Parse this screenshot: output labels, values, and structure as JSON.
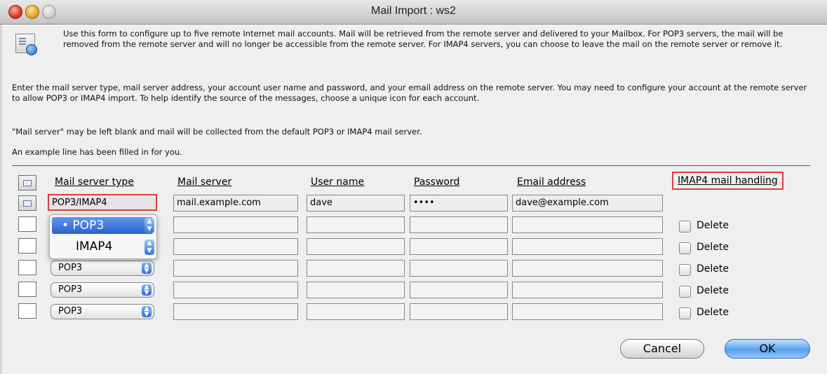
{
  "window": {
    "title": "Mail Import : ws2"
  },
  "intro": {
    "p1": "Use this form to configure up to five remote Internet mail accounts. Mail will be retrieved from the remote server and delivered to your Mailbox.  For POP3 servers, the mail will be removed from the remote server and will no longer be accessible from the remote server. For IMAP4 servers, you can choose to leave the mail on the remote server or remove it.",
    "p2": "Enter the mail server type, mail server address, your account user name and password, and your email address on the remote server. You may need to configure your account at the remote server to allow POP3 or IMAP4 import.  To help identify the source of the messages, choose a unique icon for each account.",
    "p3": "\"Mail server\" may be left blank and mail will be collected from the default POP3 or IMAP4 mail server.",
    "p4": "An example line has been filled in for you."
  },
  "columns": {
    "type": "Mail server type",
    "server": "Mail server",
    "user": "User name",
    "password": "Password",
    "email": "Email address",
    "imap": "IMAP4 mail handling"
  },
  "example": {
    "type": "POP3/IMAP4",
    "server": "mail.example.com",
    "user": "dave",
    "password": "••••",
    "email": "dave@example.com"
  },
  "popup": {
    "options": [
      "• POP3",
      "IMAP4"
    ]
  },
  "rows": [
    {
      "type": "POP3",
      "checkbox": "Delete"
    },
    {
      "type": "POP3",
      "checkbox": "Delete"
    },
    {
      "type": "POP3",
      "checkbox": "Delete"
    },
    {
      "type": "POP3",
      "checkbox": "Delete"
    },
    {
      "type": "POP3",
      "checkbox": "Delete"
    }
  ],
  "buttons": {
    "cancel": "Cancel",
    "ok": "OK"
  }
}
